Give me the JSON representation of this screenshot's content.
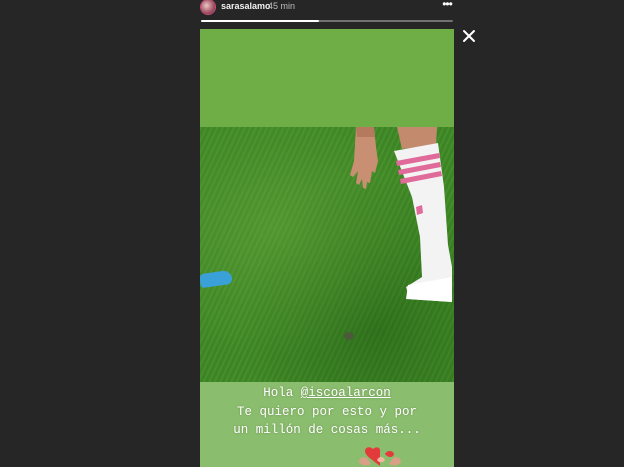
{
  "story": {
    "username": "sarasalamo",
    "timestamp": "45 min",
    "progress": 0.47,
    "caption": {
      "greeting": "Hola ",
      "mention": "@iscoalarcon",
      "line2": "Te quiero por esto y por",
      "line3": "un millón de cosas más..."
    }
  },
  "icons": {
    "more": "more-options-icon",
    "close": "close-icon",
    "sticker": "heart-hands-sticker"
  },
  "colors": {
    "background": "#262626",
    "top_band": "#6fad46",
    "caption_band": "#8bbd6e",
    "pitch": "#3f8a25"
  }
}
